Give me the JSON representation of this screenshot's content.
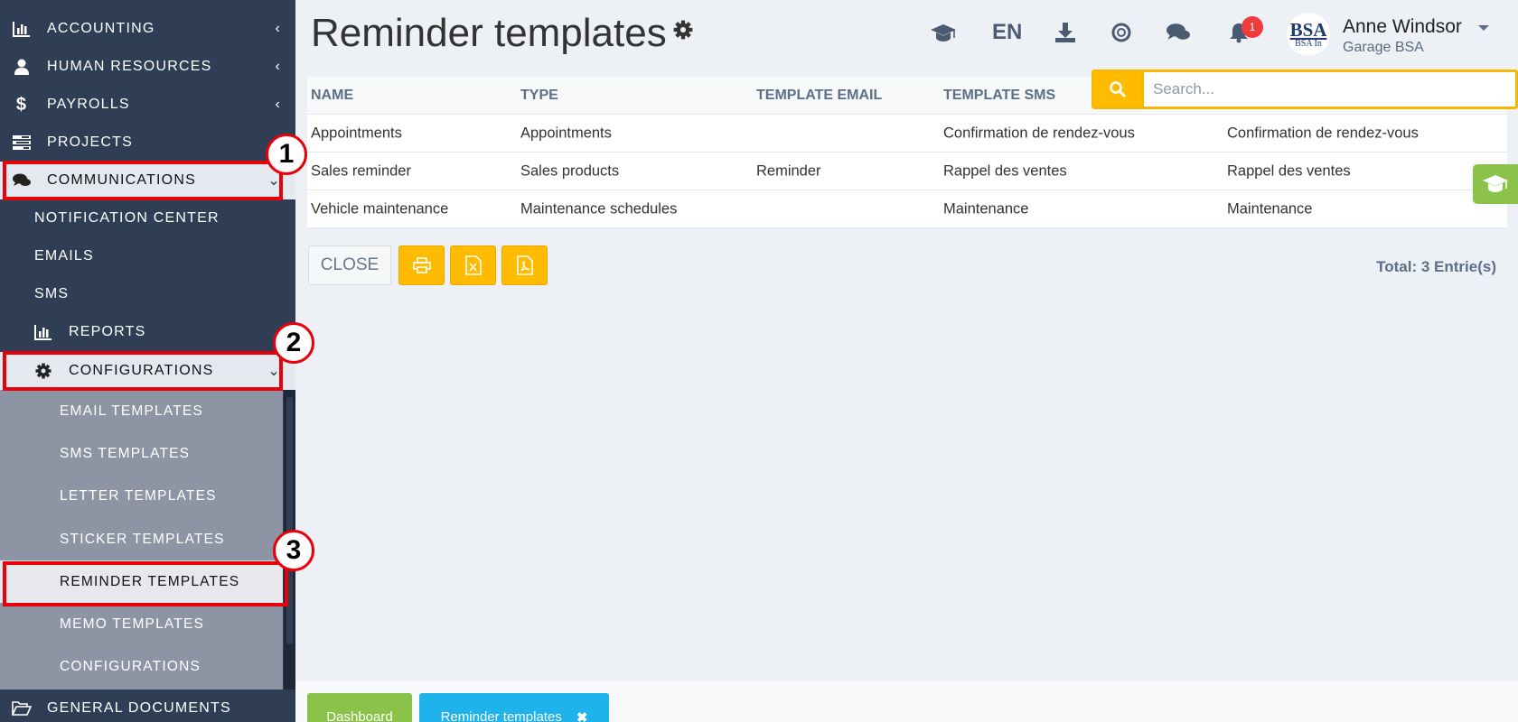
{
  "sidebar": {
    "accounting": "ACCOUNTING",
    "human_resources": "HUMAN RESOURCES",
    "payrolls": "PAYROLLS",
    "projects": "PROJECTS",
    "communications": "COMMUNICATIONS",
    "notification_center": "NOTIFICATION CENTER",
    "emails": "EMAILS",
    "sms": "SMS",
    "reports": "REPORTS",
    "configurations": "CONFIGURATIONS",
    "email_templates": "EMAIL TEMPLATES",
    "sms_templates": "SMS TEMPLATES",
    "letter_templates": "LETTER TEMPLATES",
    "sticker_templates": "STICKER TEMPLATES",
    "reminder_templates": "REMINDER TEMPLATES",
    "memo_templates": "MEMO TEMPLATES",
    "configurations_sub": "CONFIGURATIONS",
    "general_documents": "GENERAL DOCUMENTS"
  },
  "annotations": {
    "one": "1",
    "two": "2",
    "three": "3"
  },
  "header": {
    "title": "Reminder templates",
    "language": "EN",
    "notification_count": "1",
    "user_name": "Anne Windsor",
    "user_company": "Garage BSA",
    "avatar_top": "BSA",
    "avatar_bottom": "BSA In"
  },
  "search": {
    "placeholder": "Search..."
  },
  "table": {
    "headers": [
      "NAME",
      "TYPE",
      "TEMPLATE EMAIL",
      "TEMPLATE SMS"
    ],
    "rows": [
      [
        "Appointments",
        "Appointments",
        "",
        "Confirmation de rendez-vous",
        "Confirmation de rendez-vous"
      ],
      [
        "Sales reminder",
        "Sales products",
        "Reminder",
        "Rappel des ventes",
        "Rappel des ventes"
      ],
      [
        "Vehicle maintenance",
        "Maintenance schedules",
        "",
        "Maintenance",
        "Maintenance"
      ]
    ]
  },
  "toolbar": {
    "close_label": "CLOSE",
    "total": "Total: 3 Entrie(s)"
  },
  "tabs": {
    "dashboard": "Dashboard",
    "reminder_templates": "Reminder templates",
    "close_glyph": "✖"
  },
  "colors": {
    "sidebar_bg": "#2f3e55",
    "accent_yellow": "#ffbb00",
    "highlight_red": "#e8000b",
    "tab_green": "#8bc34a",
    "tab_blue": "#1fb3ec"
  }
}
